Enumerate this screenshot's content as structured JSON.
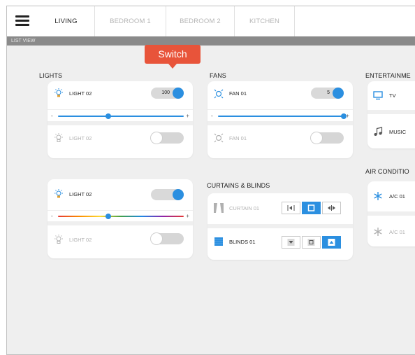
{
  "tabs": [
    {
      "label": "LIVING",
      "active": true
    },
    {
      "label": "BEDROOM 1",
      "active": false
    },
    {
      "label": "BEDROOM 2",
      "active": false
    },
    {
      "label": "KITCHEN",
      "active": false
    }
  ],
  "list_view_label": "LIST VIEW",
  "tooltip": "Switch",
  "lights": {
    "title": "LIGHTS",
    "items": [
      {
        "label": "LIGHT 02",
        "state": "on",
        "value": "100"
      },
      {
        "label": "LIGHT 02",
        "state": "off"
      },
      {
        "label": "LIGHT 02",
        "state": "on"
      },
      {
        "label": "LIGHT 02",
        "state": "off"
      }
    ],
    "dimmer_level": 0.4,
    "color_level": 0.4
  },
  "fans": {
    "title": "FANS",
    "items": [
      {
        "label": "FAN 01",
        "state": "on",
        "value": "5"
      },
      {
        "label": "FAN 01",
        "state": "off"
      }
    ],
    "speed_level": 1.0
  },
  "curtains": {
    "title": "CURTAINS & BLINDS",
    "items": [
      {
        "label": "CURTAIN 01",
        "active_button": "stop"
      },
      {
        "label": "BLINDS 01",
        "active_button": "up"
      }
    ]
  },
  "entertainment": {
    "title": "ENTERTAINME",
    "items": [
      {
        "label": "TV",
        "icon": "monitor-icon"
      },
      {
        "label": "MUSIC",
        "icon": "music-note-icon"
      }
    ]
  },
  "air": {
    "title": "AIR CONDITIO",
    "items": [
      {
        "label": "A/C 01",
        "icon": "snowflake-icon"
      },
      {
        "label": "A/C 01",
        "icon": "snowflake-icon"
      }
    ]
  },
  "slider_signs": {
    "minus": "-",
    "plus": "+"
  },
  "colors": {
    "accent": "#2b8fe0",
    "tooltip": "#e8543a",
    "background": "#efefef",
    "list_bar": "#8a8a8a"
  }
}
